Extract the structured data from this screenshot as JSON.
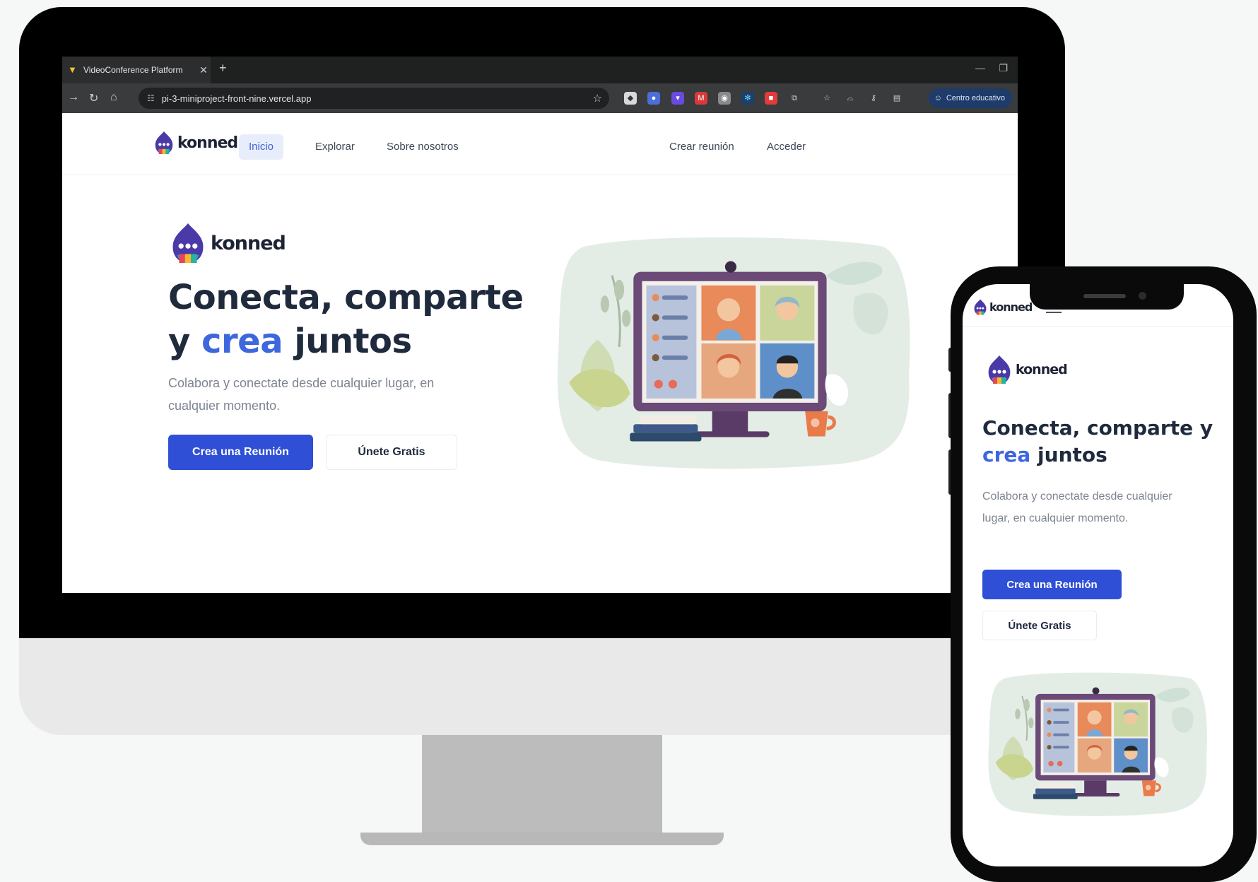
{
  "browser": {
    "tab_title": "VideoConference Platform",
    "url": "pi-3-miniproject-front-nine.vercel.app",
    "profile_chip": "Centro educativo",
    "icons": [
      "vite-favicon",
      "close-icon",
      "plus-icon",
      "back-icon",
      "reload-icon",
      "home-icon",
      "site-settings-icon",
      "star-icon",
      "extensions-icon"
    ]
  },
  "site": {
    "brand": "konned",
    "nav": {
      "inicio": "Inicio",
      "explorar": "Explorar",
      "sobre": "Sobre nosotros",
      "crear": "Crear reunión",
      "acceder": "Acceder"
    },
    "hero": {
      "title_line1": "Conecta, comparte",
      "title_y": "y",
      "title_accent": "crea",
      "title_end": "juntos",
      "subtitle": "Colabora y conectate desde cualquier lugar, en cualquier momento.",
      "primary_button": "Crea una Reunión",
      "secondary_button": "Únete Gratis"
    }
  },
  "mobile": {
    "brand": "konned",
    "title_line1": "Conecta, comparte y",
    "title_accent": "crea",
    "title_end": "juntos",
    "subtitle": "Colabora y conectate desde cualquier lugar, en cualquier momento.",
    "primary_button": "Crea una Reunión",
    "secondary_button": "Únete Gratis"
  },
  "colors": {
    "accent": "#3e67de",
    "primary_button": "#2f4fd6",
    "heading": "#1f2a3d",
    "muted_text": "#7d8491"
  }
}
